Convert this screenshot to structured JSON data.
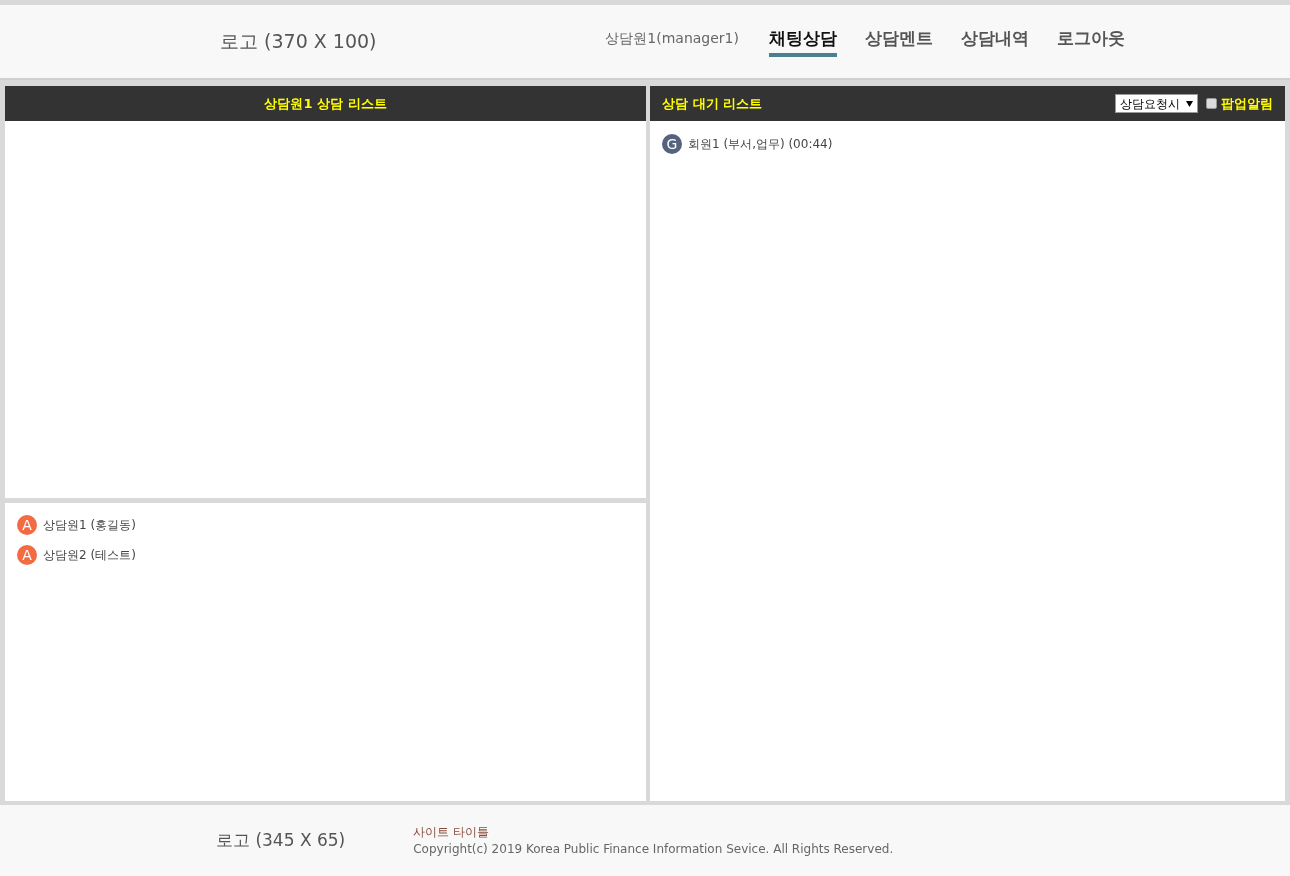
{
  "header": {
    "logo": "로고 (370 X 100)",
    "user": "상담원1(manager1)",
    "nav": [
      {
        "label": "채팅상담",
        "selected": true
      },
      {
        "label": "상담멘트",
        "selected": false
      },
      {
        "label": "상담내역",
        "selected": false
      },
      {
        "label": "로그아웃",
        "selected": false
      }
    ]
  },
  "left_panel": {
    "title": "상담원1 상담 리스트",
    "agents": [
      {
        "avatar": "A",
        "color": "#f26b43",
        "name": "상담원1 (홍길동)"
      },
      {
        "avatar": "A",
        "color": "#f26b43",
        "name": "상담원2 (테스트)"
      }
    ]
  },
  "right_panel": {
    "title": "상담 대기 리스트",
    "select": {
      "value": "상담요청시"
    },
    "popup_alert": {
      "label": "팝업알림",
      "checked": false
    },
    "waiting": [
      {
        "avatar": "G",
        "color": "#56637f",
        "name": "회원1 (부서,업무) (00:44)"
      }
    ]
  },
  "footer": {
    "logo": "로고 (345 X 65)",
    "site_title": "사이트 타이틀",
    "copyright": "Copyright(c) 2019 Korea Public Finance Information Sevice. All Rights Reserved."
  }
}
